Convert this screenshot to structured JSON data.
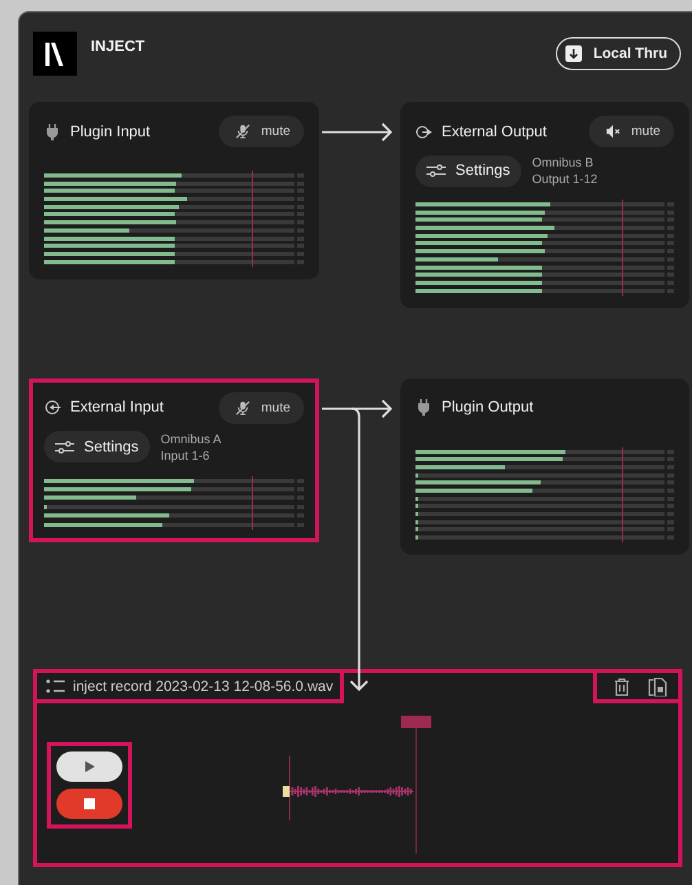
{
  "app": {
    "title": "INJECT",
    "local_thru_button": {
      "label": "Local Thru"
    }
  },
  "cards": [
    {
      "kind": "plugin_in",
      "title": "Plugin Input",
      "highlighted": false,
      "mute": {
        "kind": "mic",
        "label": "mute"
      },
      "meters": [
        {
          "level": 0.55
        },
        {
          "level": 0.53
        },
        {
          "level": 0.52
        },
        {
          "level": 0.57
        },
        {
          "level": 0.54
        },
        {
          "level": 0.52
        },
        {
          "level": 0.53
        },
        {
          "level": 0.34
        },
        {
          "level": 0.52
        },
        {
          "level": 0.52
        },
        {
          "level": 0.52
        },
        {
          "level": 0.52
        }
      ]
    },
    {
      "kind": "external_out",
      "title": "External Output",
      "highlighted": false,
      "mute": {
        "kind": "speaker",
        "label": "mute"
      },
      "settings": {
        "label": "Settings",
        "device": "Omnibus B",
        "channels": "Output 1-12"
      },
      "meters": [
        {
          "level": 0.54
        },
        {
          "level": 0.52
        },
        {
          "level": 0.51
        },
        {
          "level": 0.56
        },
        {
          "level": 0.53
        },
        {
          "level": 0.51
        },
        {
          "level": 0.52
        },
        {
          "level": 0.33
        },
        {
          "level": 0.51
        },
        {
          "level": 0.51
        },
        {
          "level": 0.51
        },
        {
          "level": 0.51
        }
      ]
    },
    {
      "kind": "external_in",
      "title": "External Input",
      "highlighted": true,
      "mute": {
        "kind": "mic",
        "label": "mute"
      },
      "settings": {
        "label": "Settings",
        "device": "Omnibus A",
        "channels": "Input 1-6"
      },
      "meters": [
        {
          "level": 0.6
        },
        {
          "level": 0.59
        },
        {
          "level": 0.37
        },
        {
          "level": 0.01
        },
        {
          "level": 0.5
        },
        {
          "level": 0.47
        }
      ]
    },
    {
      "kind": "plugin_out",
      "title": "Plugin Output",
      "highlighted": false,
      "meters": [
        {
          "level": 0.6
        },
        {
          "level": 0.59
        },
        {
          "level": 0.36
        },
        {
          "level": 0.01
        },
        {
          "level": 0.5
        },
        {
          "level": 0.47
        },
        {
          "level": 0.01
        },
        {
          "level": 0.01
        },
        {
          "level": 0.01
        },
        {
          "level": 0.01
        },
        {
          "level": 0.01
        },
        {
          "level": 0.01
        }
      ]
    }
  ],
  "recorder": {
    "highlighted": true,
    "file": {
      "name": "inject record 2023-02-13 12-08-56.0.wav",
      "highlighted": true
    },
    "actions": {
      "highlighted": true
    },
    "transport": {
      "highlighted": true
    }
  }
}
